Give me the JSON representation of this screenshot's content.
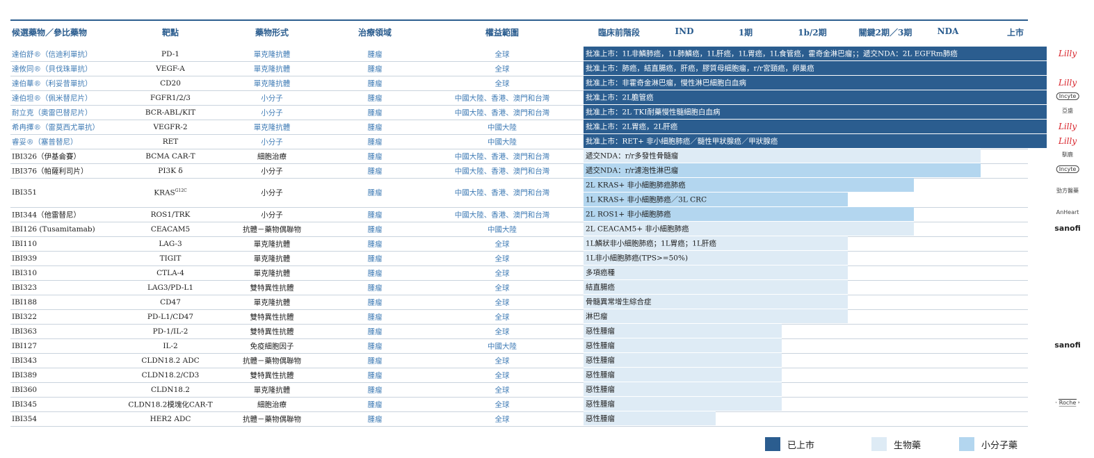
{
  "colors": {
    "approved": "#2b5d8f",
    "biologic": "#deebf5",
    "small_molecule": "#b3d6ef",
    "header": "#2b5d8f",
    "name_blue": "#3f7bb5"
  },
  "headers": {
    "candidate": "候選藥物／參比藥物",
    "target": "靶點",
    "modality": "藥物形式",
    "area": "治療領域",
    "rights": "權益範圍",
    "preclinical": "臨床前階段",
    "ind": "IND",
    "p1": "1期",
    "p1b2": "1b/2期",
    "pivotal": "關鍵2期／3期",
    "nda": "NDA",
    "launch": "上市"
  },
  "rows": [
    {
      "name": "達伯舒®（信迪利單抗）",
      "target": "PD-1",
      "modality": "單克隆抗體",
      "area": "腫瘤",
      "rights": "全球",
      "status": "approved",
      "bars": [
        {
          "label": "批准上市：1L非鱗肺癌，1L肺鱗癌，1L肝癌，1L胃癌，1L食管癌，霍奇金淋巴瘤；；遞交NDA：2L EGFRm肺癌",
          "stage": 6
        }
      ],
      "partner": "Lilly"
    },
    {
      "name": "達攸同®（貝伐珠單抗）",
      "target": "VEGF-A",
      "modality": "單克隆抗體",
      "area": "腫瘤",
      "rights": "全球",
      "status": "approved",
      "bars": [
        {
          "label": "批准上市：肺癌，結直腸癌，肝癌，膠質母細胞瘤，r/r宮頸癌，卵巢癌",
          "stage": 6
        }
      ],
      "partner": ""
    },
    {
      "name": "達伯華®（利妥昔單抗）",
      "target": "CD20",
      "modality": "單克隆抗體",
      "area": "腫瘤",
      "rights": "全球",
      "status": "approved",
      "bars": [
        {
          "label": "批准上市：非霍奇金淋巴瘤，慢性淋巴細胞白血病",
          "stage": 6
        }
      ],
      "partner": "Lilly"
    },
    {
      "name": "達伯坦®（佩米替尼片）",
      "target": "FGFR1/2/3",
      "modality": "小分子",
      "area": "腫瘤",
      "rights": "中國大陸、香港、澳門和台灣",
      "status": "approved",
      "bars": [
        {
          "label": "批准上市：2L膽管癌",
          "stage": 6
        }
      ],
      "partner": "Incyte"
    },
    {
      "name": "耐立克（奧雷巴替尼片）",
      "target": "BCR-ABL/KIT",
      "modality": "小分子",
      "area": "腫瘤",
      "rights": "中國大陸、香港、澳門和台灣",
      "status": "approved",
      "bars": [
        {
          "label": "批准上市：2L TKI耐藥慢性髓細胞白血病",
          "stage": 6
        }
      ],
      "partner": "亞盛"
    },
    {
      "name": "希冉擇®（雷莫西尤單抗）",
      "target": "VEGFR-2",
      "modality": "單克隆抗體",
      "area": "腫瘤",
      "rights": "中國大陸",
      "status": "approved",
      "bars": [
        {
          "label": "批准上市：2L胃癌，2L肝癌",
          "stage": 6
        }
      ],
      "partner": "Lilly"
    },
    {
      "name": "睿妥®（塞普替尼）",
      "target": "RET",
      "modality": "小分子",
      "area": "腫瘤",
      "rights": "中國大陸",
      "status": "approved",
      "bars": [
        {
          "label": "批准上市：RET+ 非小細胞肺癌／髓性甲狀腺癌／甲狀腺癌",
          "stage": 6
        }
      ],
      "partner": "Lilly"
    },
    {
      "name": "IBI326（伊基侖賽）",
      "target": "BCMA CAR-T",
      "modality": "細胞治療",
      "area": "腫瘤",
      "rights": "中國大陸、香港、澳門和台灣",
      "status": "biologic",
      "bars": [
        {
          "label": "遞交NDA：r/r多發性骨髓瘤",
          "stage": 5
        }
      ],
      "partner": "馴鹿"
    },
    {
      "name": "IBI376（帕薩利司片）",
      "target": "PI3K δ",
      "modality": "小分子",
      "area": "腫瘤",
      "rights": "中國大陸、香港、澳門和台灣",
      "status": "small",
      "bars": [
        {
          "label": "遞交NDA：r/r濾泡性淋巴瘤",
          "stage": 5
        }
      ],
      "partner": "Incyte"
    },
    {
      "name": "IBI351",
      "target": "KRAS",
      "target_sup": "G12C",
      "modality": "小分子",
      "area": "腫瘤",
      "rights": "中國大陸、香港、澳門和台灣",
      "status": "small",
      "bars": [
        {
          "label": "2L KRAS+ 非小細胞肺癌肺癌",
          "stage": 4
        },
        {
          "label": "1L KRAS+ 非小細胞肺癌／3L CRC",
          "stage": 3
        }
      ],
      "partner": "勁方醫藥"
    },
    {
      "name": "IBI344（他雷替尼）",
      "target": "ROS1/TRK",
      "modality": "小分子",
      "area": "腫瘤",
      "rights": "中國大陸、香港、澳門和台灣",
      "status": "small",
      "bars": [
        {
          "label": "2L ROS1+ 非小細胞肺癌",
          "stage": 4
        }
      ],
      "partner": "AnHeart"
    },
    {
      "name": "IBI126 (Tusamitamab)",
      "target": "CEACAM5",
      "modality": "抗體－藥物偶聯物",
      "area": "腫瘤",
      "rights": "中國大陸",
      "status": "biologic",
      "bars": [
        {
          "label": "2L CEACAM5+ 非小細胞肺癌",
          "stage": 4
        }
      ],
      "partner": "sanofi"
    },
    {
      "name": "IBI110",
      "target": "LAG-3",
      "modality": "單克隆抗體",
      "area": "腫瘤",
      "rights": "全球",
      "status": "biologic",
      "bars": [
        {
          "label": "1L鱗狀非小細胞肺癌；1L胃癌；1L肝癌",
          "stage": 3
        }
      ],
      "partner": ""
    },
    {
      "name": "IBI939",
      "target": "TIGIT",
      "modality": "單克隆抗體",
      "area": "腫瘤",
      "rights": "全球",
      "status": "biologic",
      "bars": [
        {
          "label": "1L非小細胞肺癌(TPS>=50%)",
          "stage": 3
        }
      ],
      "partner": ""
    },
    {
      "name": "IBI310",
      "target": "CTLA-4",
      "modality": "單克隆抗體",
      "area": "腫瘤",
      "rights": "全球",
      "status": "biologic",
      "bars": [
        {
          "label": "多項癌種",
          "stage": 3
        }
      ],
      "partner": ""
    },
    {
      "name": "IBI323",
      "target": "LAG3/PD-L1",
      "modality": "雙特異性抗體",
      "area": "腫瘤",
      "rights": "全球",
      "status": "biologic",
      "bars": [
        {
          "label": "結直腸癌",
          "stage": 3
        }
      ],
      "partner": ""
    },
    {
      "name": "IBI188",
      "target": "CD47",
      "modality": "單克隆抗體",
      "area": "腫瘤",
      "rights": "全球",
      "status": "biologic",
      "bars": [
        {
          "label": "骨髓異常增生綜合症",
          "stage": 3
        }
      ],
      "partner": ""
    },
    {
      "name": "IBI322",
      "target": "PD-L1/CD47",
      "modality": "雙特異性抗體",
      "area": "腫瘤",
      "rights": "全球",
      "status": "biologic",
      "bars": [
        {
          "label": "淋巴瘤",
          "stage": 3
        }
      ],
      "partner": ""
    },
    {
      "name": "IBI363",
      "target": "PD-1/IL-2",
      "modality": "雙特異性抗體",
      "area": "腫瘤",
      "rights": "全球",
      "status": "biologic",
      "bars": [
        {
          "label": "惡性腫瘤",
          "stage": 2
        }
      ],
      "partner": ""
    },
    {
      "name": "IBI127",
      "target": "IL-2",
      "modality": "免疫細胞因子",
      "area": "腫瘤",
      "rights": "中國大陸",
      "status": "biologic",
      "bars": [
        {
          "label": "惡性腫瘤",
          "stage": 2
        }
      ],
      "partner": "sanofi"
    },
    {
      "name": "IBI343",
      "target": "CLDN18.2 ADC",
      "modality": "抗體－藥物偶聯物",
      "area": "腫瘤",
      "rights": "全球",
      "status": "biologic",
      "bars": [
        {
          "label": "惡性腫瘤",
          "stage": 2
        }
      ],
      "partner": ""
    },
    {
      "name": "IBI389",
      "target": "CLDN18.2/CD3",
      "modality": "雙特異性抗體",
      "area": "腫瘤",
      "rights": "全球",
      "status": "biologic",
      "bars": [
        {
          "label": "惡性腫瘤",
          "stage": 2
        }
      ],
      "partner": ""
    },
    {
      "name": "IBI360",
      "target": "CLDN18.2",
      "modality": "單克隆抗體",
      "area": "腫瘤",
      "rights": "全球",
      "status": "biologic",
      "bars": [
        {
          "label": "惡性腫瘤",
          "stage": 2
        }
      ],
      "partner": ""
    },
    {
      "name": "IBI345",
      "target": "CLDN18.2模塊化CAR-T",
      "modality": "細胞治療",
      "area": "腫瘤",
      "rights": "全球",
      "status": "biologic",
      "bars": [
        {
          "label": "惡性腫瘤",
          "stage": 2
        }
      ],
      "partner": "Roche"
    },
    {
      "name": "IBI354",
      "target": "HER2 ADC",
      "modality": "抗體－藥物偶聯物",
      "area": "腫瘤",
      "rights": "全球",
      "status": "biologic",
      "bars": [
        {
          "label": "惡性腫瘤",
          "stage": 1
        }
      ],
      "partner": ""
    }
  ],
  "legend": [
    {
      "label": "已上市",
      "color": "#2b5d8f"
    },
    {
      "label": "生物藥",
      "color": "#deebf5"
    },
    {
      "label": "小分子藥",
      "color": "#b3d6ef"
    }
  ]
}
